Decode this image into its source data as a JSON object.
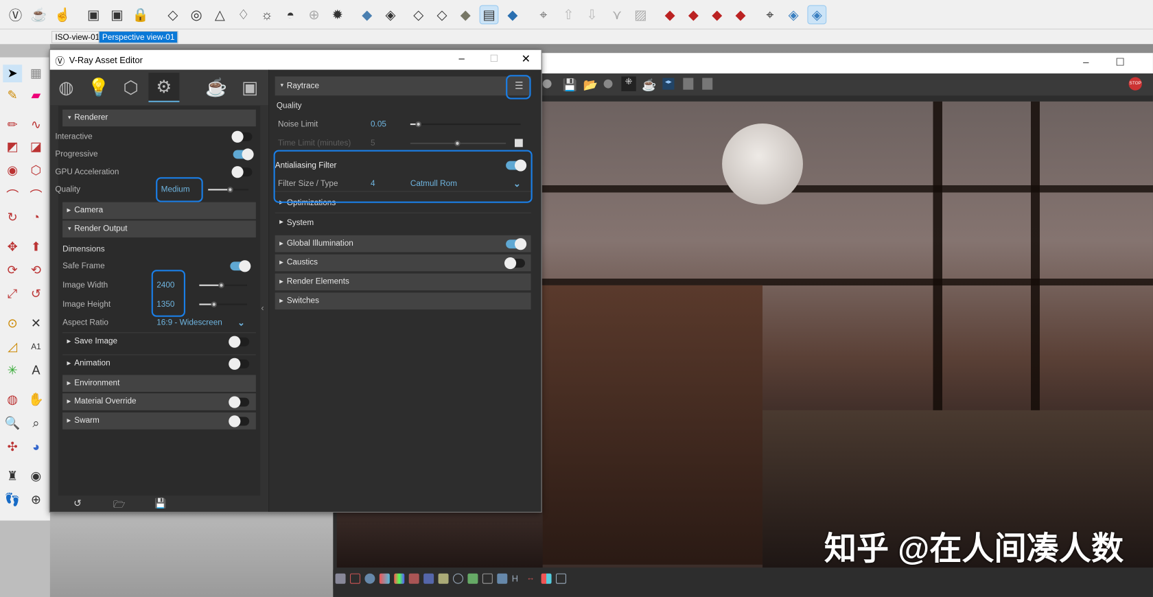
{
  "toolbar": {
    "icons": [
      "vray-logo-icon",
      "render-teapot-icon",
      "interactive-render-icon",
      "frame-buffer-icon",
      "frame-buffer-teapot-icon",
      "lock-icon",
      "rect-light-icon",
      "sphere-light-icon",
      "spot-light-icon",
      "ies-light-icon",
      "omni-light-icon",
      "dome-light-icon",
      "mesh-light-icon",
      "ambient-light-icon",
      "style-xray-icon",
      "style-backedges-icon",
      "style-wireframe-icon",
      "style-hidden-line-icon",
      "style-shaded-icon",
      "style-textured-icon",
      "style-monochrome-icon"
    ]
  },
  "view_tabs": [
    {
      "label": "ISO-view-01",
      "active": false
    },
    {
      "label": "Perspective view-01",
      "active": true
    }
  ],
  "editor": {
    "title": "V-Ray Asset Editor",
    "tabs": [
      "materials-icon",
      "lights-icon",
      "geometry-icon",
      "settings-icon",
      "render-icon",
      "frame-buffer-icon"
    ],
    "left": {
      "renderer": {
        "label": "Renderer",
        "interactive": {
          "label": "Interactive",
          "on": false
        },
        "progressive": {
          "label": "Progressive",
          "on": true
        },
        "gpu": {
          "label": "GPU Acceleration",
          "on": false
        },
        "quality": {
          "label": "Quality",
          "value": "Medium",
          "slider": 0.55
        }
      },
      "camera": "Camera",
      "render_output": {
        "label": "Render Output",
        "dimensions": "Dimensions",
        "safe_frame": {
          "label": "Safe Frame",
          "on": true
        },
        "width": {
          "label": "Image Width",
          "value": "2400",
          "slider": 0.45
        },
        "height": {
          "label": "Image Height",
          "value": "1350",
          "slider": 0.3
        },
        "aspect": {
          "label": "Aspect Ratio",
          "value": "16:9 - Widescreen"
        }
      },
      "save_image": {
        "label": "Save Image",
        "on": false
      },
      "animation": {
        "label": "Animation",
        "on": false
      },
      "environment": "Environment",
      "material_override": {
        "label": "Material Override",
        "on": false
      },
      "swarm": {
        "label": "Swarm",
        "on": false
      }
    },
    "right": {
      "raytrace": "Raytrace",
      "quality": "Quality",
      "noise_limit": {
        "label": "Noise Limit",
        "value": "0.05"
      },
      "time_limit": {
        "label": "Time Limit (minutes)",
        "value": "5"
      },
      "aa_filter": {
        "label": "Antialiasing Filter",
        "on": true
      },
      "filter": {
        "label": "Filter Size / Type",
        "size": "4",
        "type": "Catmull Rom"
      },
      "optimizations": "Optimizations",
      "system": "System",
      "gi": {
        "label": "Global Illumination",
        "on": true
      },
      "caustics": {
        "label": "Caustics",
        "on": false
      },
      "render_elements": "Render Elements",
      "switches": "Switches"
    }
  },
  "vfb": {
    "watermark": "知乎 @在人间凑人数"
  }
}
